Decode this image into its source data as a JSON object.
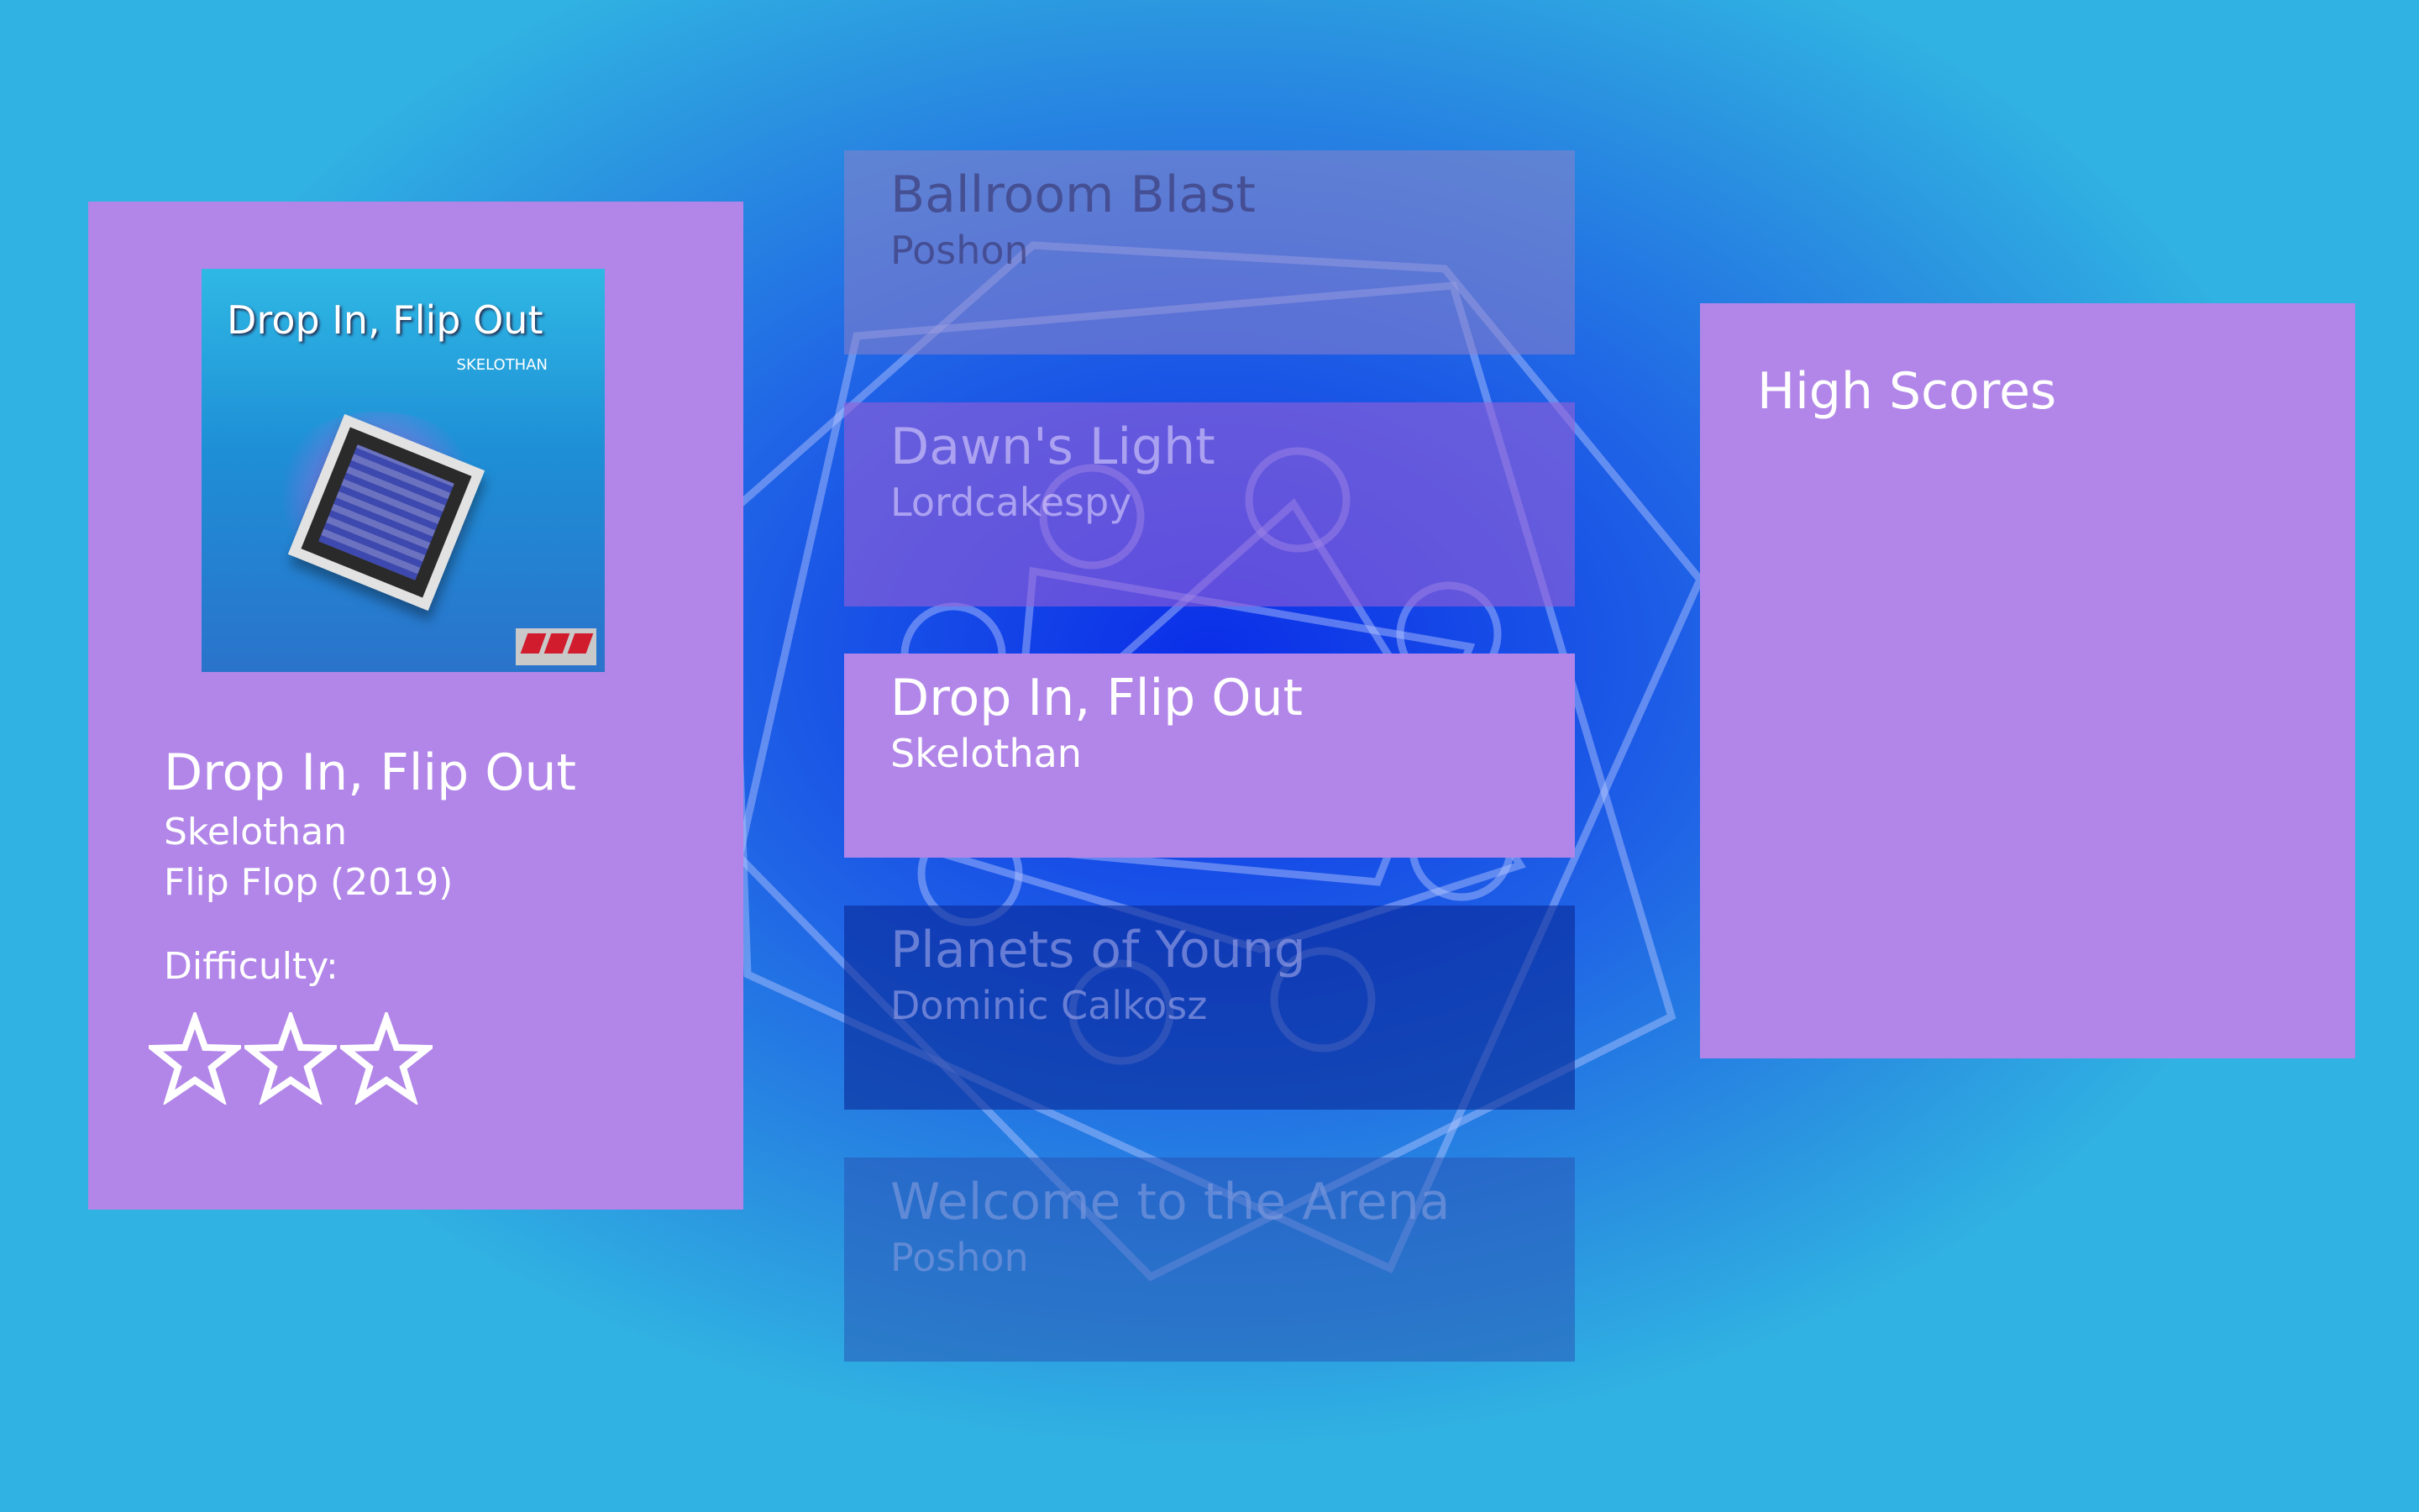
{
  "selected": {
    "title": "Drop In, Flip Out",
    "artist": "Skelothan",
    "album": "Flip Flop (2019)",
    "difficulty_label": "Difficulty:",
    "difficulty_stars": 0,
    "difficulty_max": 3,
    "cover": {
      "title": "Drop In, Flip Out",
      "artist": "SKELOTHAN"
    }
  },
  "song_list": [
    {
      "title": "Ballroom Blast",
      "artist": "Poshon"
    },
    {
      "title": "Dawn's Light",
      "artist": "Lordcakespy"
    },
    {
      "title": "Drop In, Flip Out",
      "artist": "Skelothan"
    },
    {
      "title": "Planets of Young",
      "artist": "Dominic Calkosz"
    },
    {
      "title": "Welcome to the Arena",
      "artist": "Poshon"
    }
  ],
  "high_scores": {
    "title": "High Scores"
  },
  "colors": {
    "panel": "#b186e8",
    "background": "#1f62e6",
    "text": "#ffffff"
  }
}
